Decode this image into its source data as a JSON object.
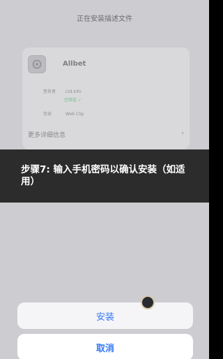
{
  "header": {
    "title": "正在安装描述文件"
  },
  "profile": {
    "app_icon": "gear-icon",
    "name": "Allbet",
    "signer_key": "签名者",
    "signer_value": "Ltd.Info",
    "verified_label": "已验证",
    "type_key": "包含",
    "type_value": "Web Clip",
    "more_details": "更多详细信息"
  },
  "instruction": {
    "text": "步骤7: 输入手机密码以确认安装（如适用）"
  },
  "actions": {
    "install_label": "安装",
    "cancel_label": "取消"
  },
  "colors": {
    "accent": "#3478f6",
    "banner": "#2c2c2c",
    "verified": "#62c47a"
  }
}
